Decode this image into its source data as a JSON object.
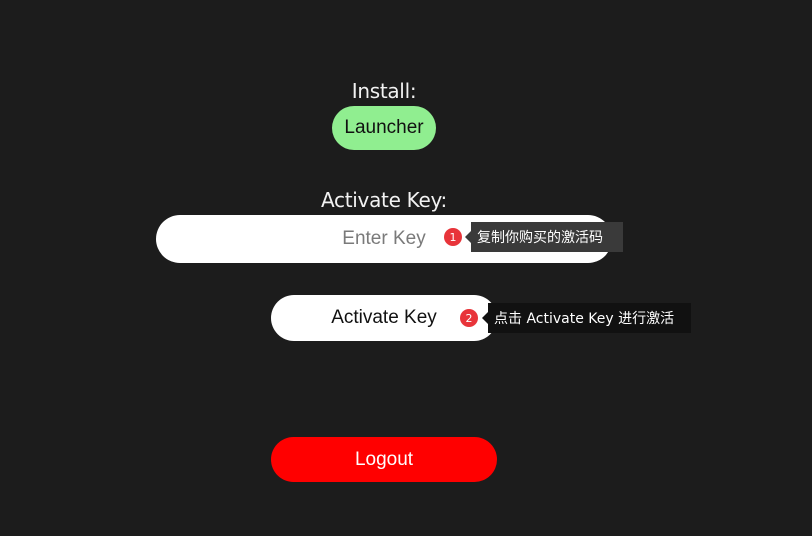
{
  "install": {
    "label": "Install:",
    "launcher_button": "Launcher"
  },
  "activate": {
    "label": "Activate Key:",
    "key_input_placeholder": "Enter Key",
    "key_input_value": "",
    "activate_button": "Activate Key"
  },
  "logout_button": "Logout",
  "guide": {
    "steps": [
      {
        "number": "1",
        "tip": "复制你购买的激活码"
      },
      {
        "number": "2",
        "tip": "点击 Activate Key 进行激活"
      }
    ]
  },
  "colors": {
    "background": "#1c1c1c",
    "launcher": "#90ee90",
    "logout": "#ff0000",
    "badge": "#e8343a"
  }
}
